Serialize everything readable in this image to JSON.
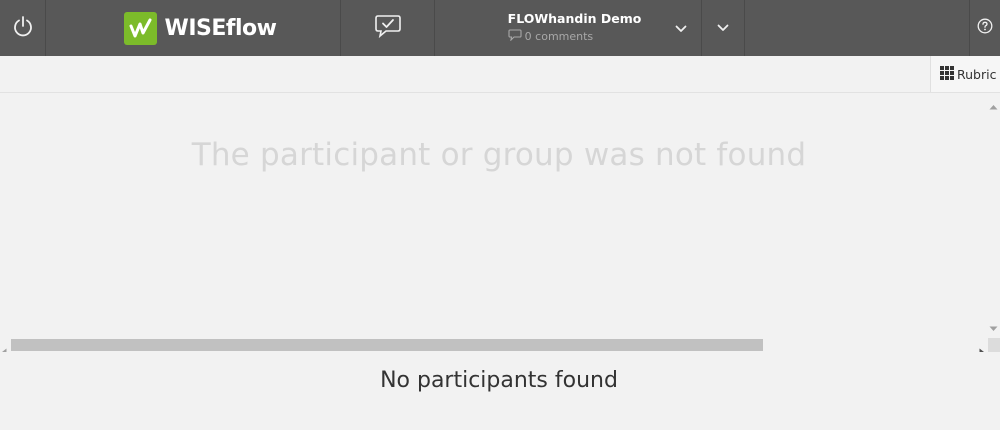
{
  "brand": {
    "name": "WISEflow"
  },
  "flow": {
    "title": "FLOWhandin Demo",
    "comments": "0 comments"
  },
  "toolbar": {
    "rubric_label": "Rubric"
  },
  "content": {
    "not_found_message": "The participant or group was not found"
  },
  "participants": {
    "empty_message": "No participants found"
  },
  "colors": {
    "topbar": "#585858",
    "logo_green": "#7cbb2a",
    "background": "#f2f2f2"
  },
  "icons": [
    "power-icon",
    "wiseflow-logo-icon",
    "chat-check-icon",
    "comment-icon",
    "chevron-down-icon",
    "help-icon",
    "grid-icon"
  ]
}
